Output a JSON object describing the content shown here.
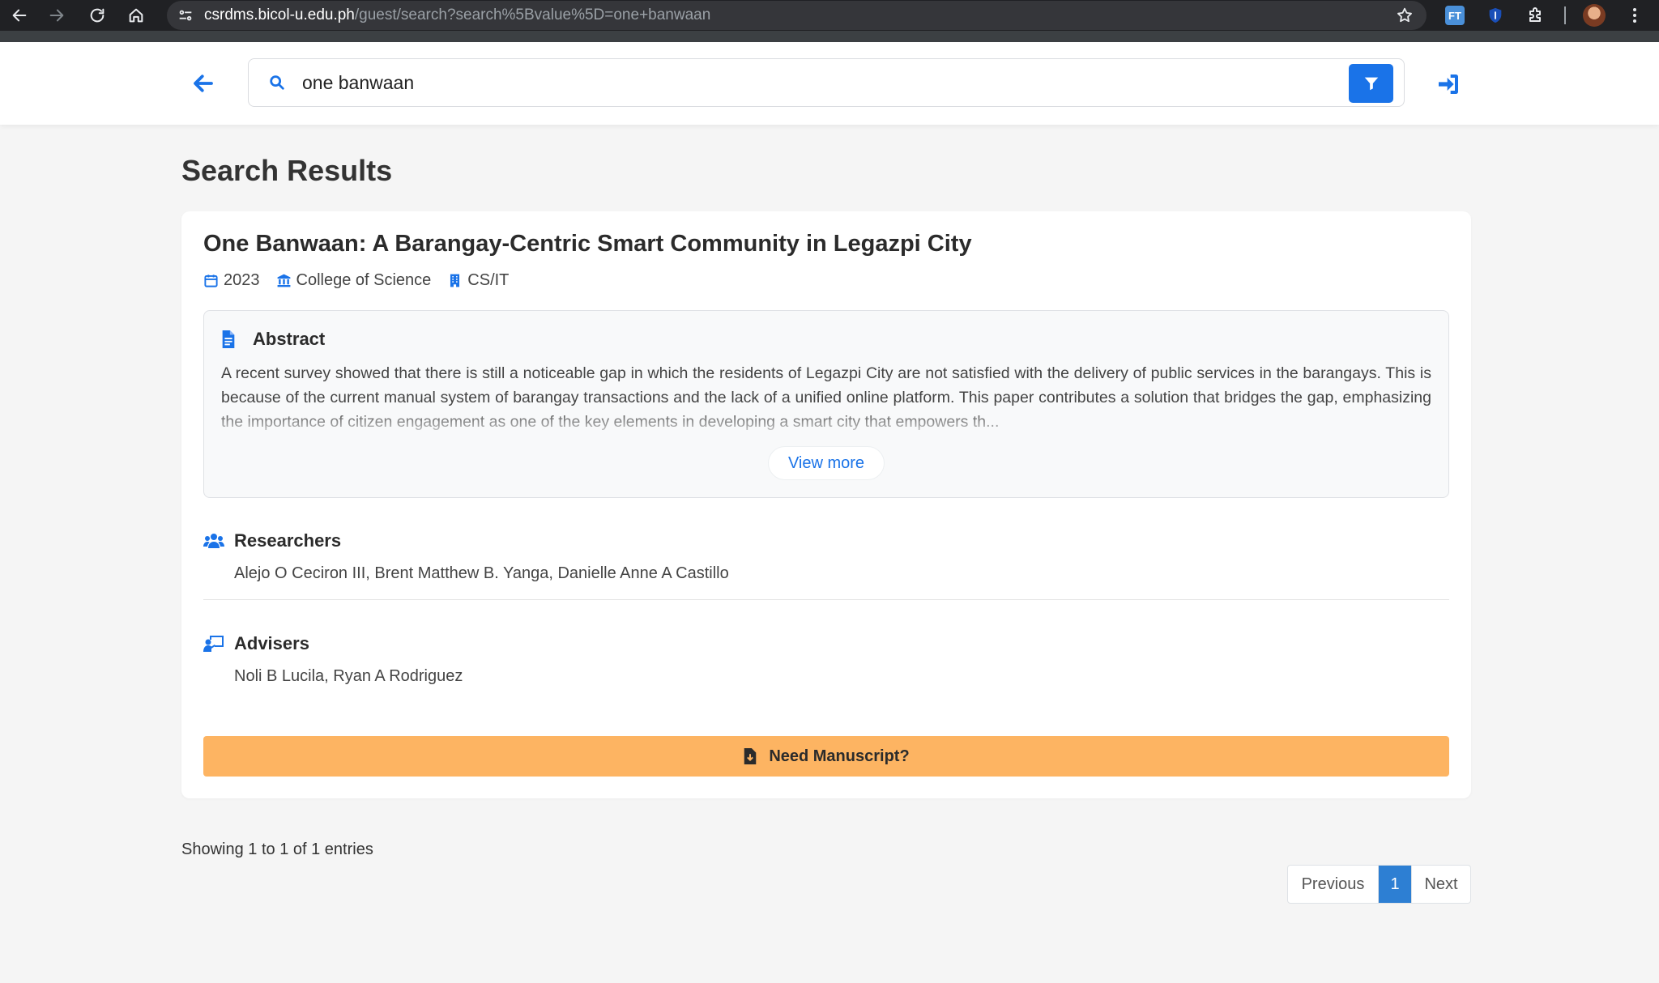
{
  "browser": {
    "url_host": "csrdms.bicol-u.edu.ph",
    "url_path": "/guest/search?search%5Bvalue%5D=one+banwaan",
    "extensions": [
      {
        "name": "translate-extension-icon",
        "label": "FT",
        "color": "#4a90d9"
      },
      {
        "name": "shield-extension-icon",
        "label": "",
        "color": "#1a4fb8"
      }
    ]
  },
  "header": {
    "search_value": "one banwaan"
  },
  "page": {
    "title": "Search Results"
  },
  "result": {
    "title": "One Banwaan: A Barangay-Centric Smart Community in Legazpi City",
    "year": "2023",
    "college": "College of Science",
    "department": "CS/IT",
    "abstract_heading": "Abstract",
    "abstract_text": "A recent survey showed that there is still a noticeable gap in which the residents of Legazpi City are not satisfied with the delivery of public services in the barangays. This is because of the current manual system of barangay transactions and the lack of a unified online platform. This paper contributes a solution that bridges the gap, emphasizing the importance of citizen engagement as one of the key elements in developing a smart city that empowers th...",
    "view_more_label": "View more",
    "researchers_heading": "Researchers",
    "researchers": "Alejo O Ceciron III, Brent Matthew B. Yanga, Danielle Anne A Castillo",
    "advisers_heading": "Advisers",
    "advisers": "Noli B Lucila, Ryan A Rodriguez",
    "manuscript_label": "Need Manuscript?"
  },
  "footer": {
    "showing_text": "Showing 1 to 1 of 1 entries",
    "prev_label": "Previous",
    "current_page": "1",
    "next_label": "Next"
  },
  "colors": {
    "accent": "#1a73e8",
    "manuscript": "#fdb462",
    "page_active": "#2d7fd3"
  }
}
